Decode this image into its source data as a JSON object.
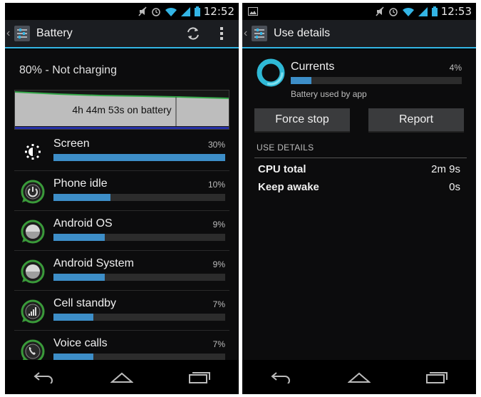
{
  "battery_screen": {
    "status_time": "12:52",
    "title": "Battery",
    "refresh_icon": "refresh-icon",
    "overflow_icon": "overflow-menu-icon",
    "charge_status": "80% - Not charging",
    "graph_label": "4h 44m 53s on battery",
    "usage": [
      {
        "label": "Screen",
        "pct_text": "30%",
        "fraction": 0.3,
        "icon": "brightness-icon"
      },
      {
        "label": "Phone idle",
        "pct_text": "10%",
        "fraction": 0.1,
        "icon": "power-icon"
      },
      {
        "label": "Android OS",
        "pct_text": "9%",
        "fraction": 0.09,
        "icon": "android-os-icon"
      },
      {
        "label": "Android System",
        "pct_text": "9%",
        "fraction": 0.09,
        "icon": "android-system-icon"
      },
      {
        "label": "Cell standby",
        "pct_text": "7%",
        "fraction": 0.07,
        "icon": "cell-signal-icon"
      },
      {
        "label": "Voice calls",
        "pct_text": "7%",
        "fraction": 0.07,
        "icon": "phone-call-icon"
      }
    ]
  },
  "details_screen": {
    "status_time": "12:53",
    "title": "Use details",
    "app_name": "Currents",
    "app_pct_text": "4%",
    "app_fraction": 0.04,
    "app_subtitle": "Battery used by app",
    "force_stop_label": "Force stop",
    "report_label": "Report",
    "section_header": "USE DETAILS",
    "details": [
      {
        "label": "CPU total",
        "value": "2m 9s"
      },
      {
        "label": "Keep awake",
        "value": "0s"
      }
    ]
  },
  "colors": {
    "accent": "#33b5e5",
    "bar_fill": "#3d8ec8",
    "icon_green": "#3a9a3a"
  }
}
